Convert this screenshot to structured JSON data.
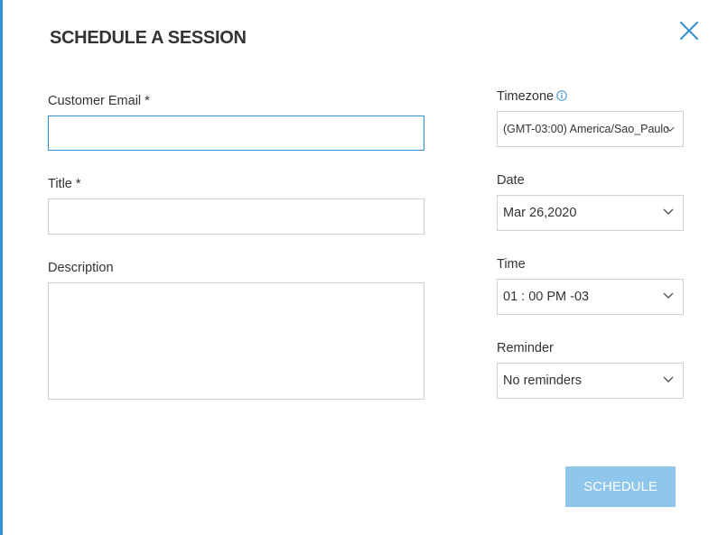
{
  "dialog": {
    "title": "SCHEDULE A SESSION",
    "accent_color": "#2d8fd5"
  },
  "form": {
    "customer_email": {
      "label": "Customer Email *",
      "value": ""
    },
    "title": {
      "label": "Title *",
      "value": ""
    },
    "description": {
      "label": "Description",
      "value": ""
    }
  },
  "sidebar": {
    "timezone": {
      "label": "Timezone",
      "value": "(GMT-03:00) America/Sao_Paulo",
      "info_icon": "info-icon"
    },
    "date": {
      "label": "Date",
      "value": "Mar 26,2020"
    },
    "time": {
      "label": "Time",
      "value": "01 : 00 PM -03"
    },
    "reminder": {
      "label": "Reminder",
      "value": "No reminders"
    }
  },
  "actions": {
    "schedule_label": "SCHEDULE",
    "schedule_color": "#8ec6ec",
    "close_icon": "close-icon"
  }
}
